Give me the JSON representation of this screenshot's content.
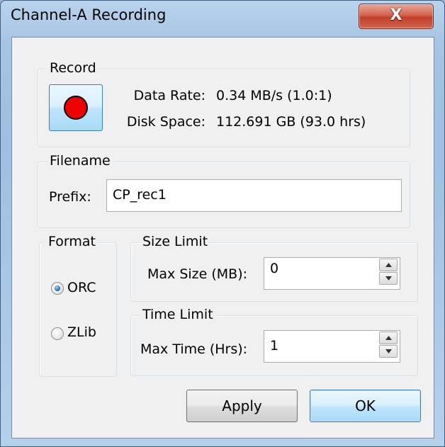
{
  "window": {
    "title": "Channel-A Recording",
    "close_glyph": "X"
  },
  "record": {
    "legend": "Record",
    "button_icon": "record-dot-icon",
    "data_rate_label": "Data Rate:",
    "data_rate_value": "0.34 MB/s (1.0:1)",
    "disk_space_label": "Disk Space:",
    "disk_space_value": "112.691 GB (93.0 hrs)"
  },
  "filename": {
    "legend": "Filename",
    "prefix_label": "Prefix:",
    "prefix_value": "CP_rec1"
  },
  "format": {
    "legend": "Format",
    "options": [
      {
        "label": "ORC",
        "selected": true
      },
      {
        "label": "ZLib",
        "selected": false
      }
    ]
  },
  "size_limit": {
    "legend": "Size Limit",
    "label": "Max Size (MB):",
    "value": "0"
  },
  "time_limit": {
    "legend": "Time Limit",
    "label": "Max Time (Hrs):",
    "value": "1"
  },
  "buttons": {
    "apply": "Apply",
    "ok": "OK"
  },
  "colors": {
    "record_dot": "#f00000",
    "default_button": "#bee6fd",
    "close_button": "#c0402a"
  }
}
